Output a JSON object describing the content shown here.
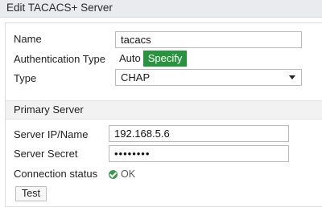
{
  "dialog": {
    "title": "Edit TACACS+ Server"
  },
  "form": {
    "name_label": "Name",
    "name_value": "tacacs",
    "auth_type_label": "Authentication Type",
    "auth_options": [
      "Auto",
      "Specify"
    ],
    "auth_selected": "Specify",
    "type_label": "Type",
    "type_value": "CHAP",
    "primary_section": "Primary Server",
    "server_ip_label": "Server IP/Name",
    "server_ip_value": "192.168.5.6",
    "server_secret_label": "Server Secret",
    "server_secret_value": "••••••••",
    "conn_status_label": "Connection status",
    "conn_status_value": "OK",
    "test_button": "Test"
  },
  "colors": {
    "accent_green": "#29943e",
    "ok_green": "#3c9a4d"
  },
  "icons": {
    "status": "ok-check-icon",
    "dropdown": "caret-down-icon"
  }
}
